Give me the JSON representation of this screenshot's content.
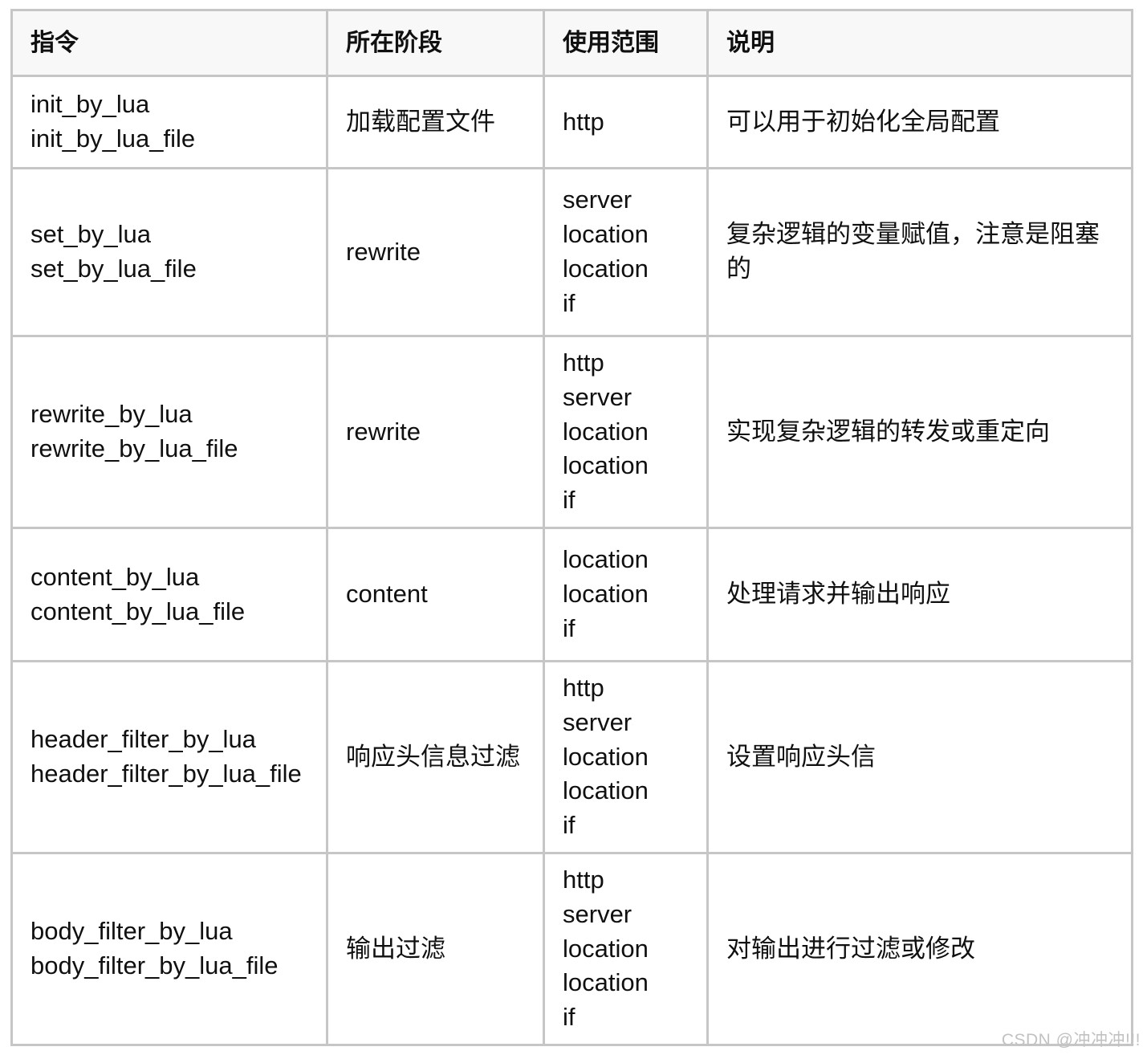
{
  "table": {
    "columns": [
      {
        "key": "directive",
        "label": "指令"
      },
      {
        "key": "phase",
        "label": "所在阶段"
      },
      {
        "key": "scope",
        "label": "使用范围"
      },
      {
        "key": "description",
        "label": "说明"
      }
    ],
    "rows": [
      {
        "directive": "init_by_lua\ninit_by_lua_file",
        "phase": "加载配置文件",
        "scope": "http",
        "description": "可以用于初始化全局配置"
      },
      {
        "directive": "set_by_lua\nset_by_lua_file",
        "phase": "rewrite",
        "scope": "server\nlocation\nlocation\nif",
        "description": "复杂逻辑的变量赋值，注意是阻塞的"
      },
      {
        "directive": "rewrite_by_lua\nrewrite_by_lua_file",
        "phase": "rewrite",
        "scope": "http\nserver\nlocation\nlocation\nif",
        "description": "实现复杂逻辑的转发或重定向"
      },
      {
        "directive": "content_by_lua\ncontent_by_lua_file",
        "phase": "content",
        "scope": "location\nlocation\nif",
        "description": "处理请求并输出响应"
      },
      {
        "directive": "header_filter_by_lua\nheader_filter_by_lua_file",
        "phase": "响应头信息过滤",
        "scope": "http\nserver\nlocation\nlocation\nif",
        "description": "设置响应头信"
      },
      {
        "directive": "body_filter_by_lua\nbody_filter_by_lua_file",
        "phase": "输出过滤",
        "scope": "http\nserver\nlocation\nlocation\nif",
        "description": "对输出进行过滤或修改"
      }
    ]
  },
  "watermark": {
    "text": "CSDN @冲冲冲!!!"
  },
  "colors": {
    "border": "#c6c6c6",
    "header_background": "#f8f8f8",
    "text": "#101010",
    "watermark": "#c2c2c2"
  }
}
